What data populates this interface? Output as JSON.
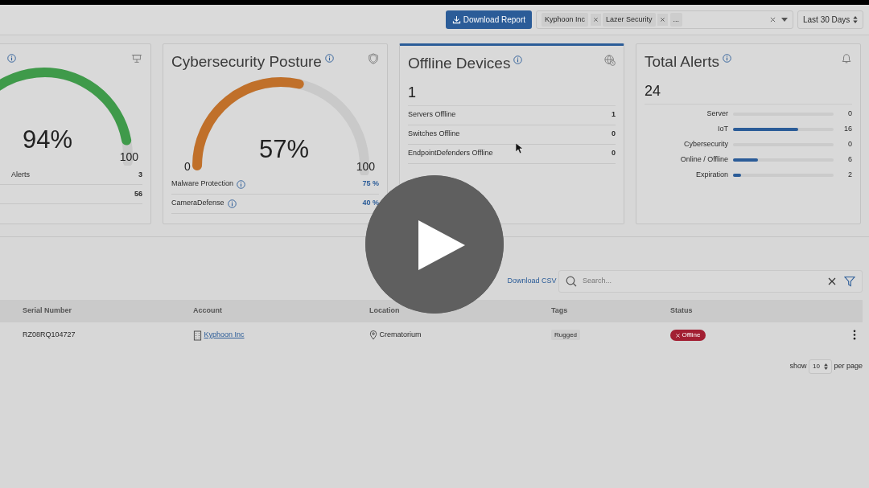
{
  "header": {
    "download_button": "Download Report",
    "account_filter": {
      "chips": [
        "Kyphoon Inc",
        "Lazer Security"
      ],
      "more": "..."
    },
    "date_range": "Last 30 Days"
  },
  "cards": [
    {
      "kind": "gauge",
      "value": "94%",
      "max": "100",
      "level": 0.94,
      "color": "#3f9a4a",
      "rows": [
        {
          "label": "Alerts",
          "value": "3"
        },
        {
          "value": "56"
        }
      ]
    },
    {
      "kind": "gauge",
      "title": "Cybersecurity Posture",
      "value": "57%",
      "min": "0",
      "max": "100",
      "level": 0.57,
      "color": "#c0702a",
      "rows": [
        {
          "label": "Malware Protection",
          "info": true,
          "value": "75 %"
        },
        {
          "label": "CameraDefense",
          "info": true,
          "value": "40 %"
        }
      ]
    },
    {
      "kind": "list",
      "title": "Offline Devices",
      "highlighted": true,
      "total": "1",
      "rows": [
        {
          "label": "Servers Offline",
          "value": "1"
        },
        {
          "label": "Switches Offline",
          "value": "0"
        },
        {
          "label": "EndpointDefenders Offline",
          "value": "0"
        }
      ]
    },
    {
      "kind": "bars",
      "title": "Total Alerts",
      "total": "24",
      "bars": [
        {
          "label": "Server",
          "value": "0"
        },
        {
          "label": "IoT",
          "level": 0.65,
          "value": "16"
        },
        {
          "label": "Cybersecurity",
          "value": "0"
        },
        {
          "label": "Online / Offline",
          "level": 0.25,
          "value": "6"
        },
        {
          "label": "Expiration",
          "level": 0.08,
          "value": "2"
        }
      ]
    }
  ],
  "toolbar": {
    "download_csv": "Download CSV",
    "search": {
      "placeholder": "Search..."
    }
  },
  "table": {
    "columns": [
      "Serial Number",
      "Account",
      "Location",
      "Tags",
      "Status"
    ],
    "rows": [
      {
        "serial": "RZ08RQ104727",
        "account": "Kyphoon Inc",
        "location": "Crematorium",
        "tag": "Rugged",
        "status": "Offline"
      }
    ]
  },
  "pagination": {
    "show": "show",
    "page_size": "10",
    "per_page": "per page"
  }
}
